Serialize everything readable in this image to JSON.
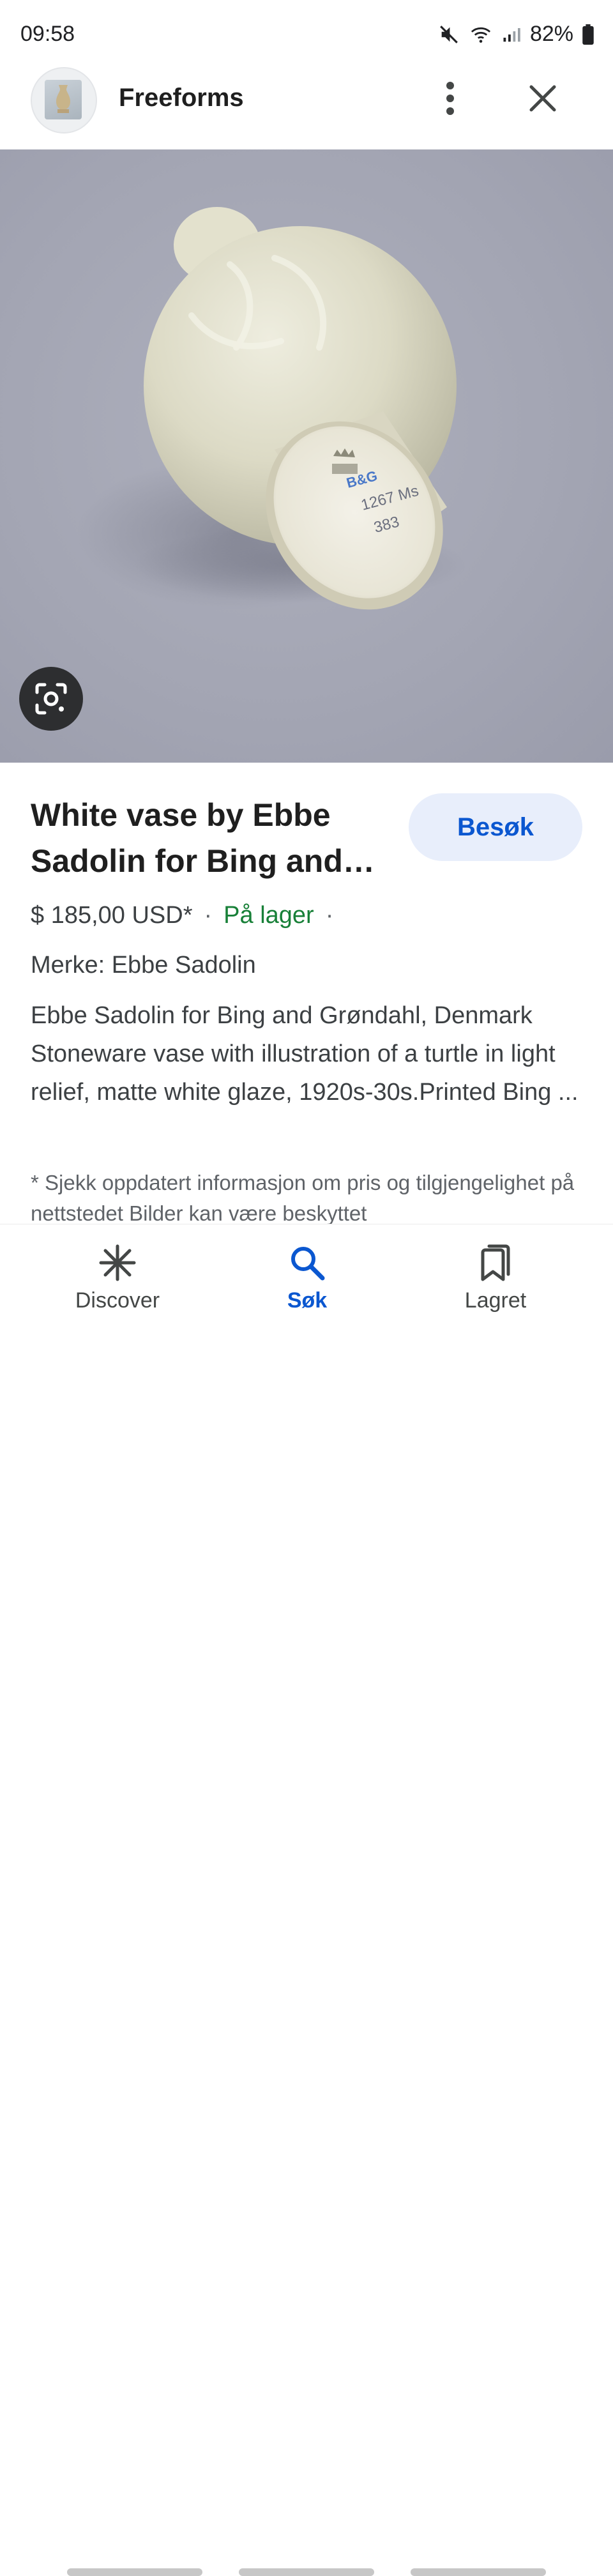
{
  "status_bar": {
    "time": "09:58",
    "battery": "82%"
  },
  "header": {
    "site_name": "Freeforms"
  },
  "product": {
    "title": "White vase by Ebbe Sadolin for Bing and…",
    "visit_label": "Besøk",
    "price": "$ 185,00 USD*",
    "separator": "·",
    "stock": "På lager",
    "brand": "Merke: Ebbe Sadolin",
    "description": "Ebbe Sadolin for Bing and Grøndahl, Denmark Stoneware vase with illustration of a turtle in light relief, matte white glaze, 1920s-30s.Printed Bing ...",
    "disclaimer": "* Sjekk oppdatert informasjon om pris og tilgjengelighet på nettstedet Bilder kan være beskyttet"
  },
  "vase_mark": {
    "line1": "B&G",
    "line2": "1267 Ms",
    "line3": "383"
  },
  "bottom_nav": {
    "items": [
      {
        "label": "Discover",
        "icon": "asterisk-icon",
        "active": false
      },
      {
        "label": "Søk",
        "icon": "search-icon",
        "active": true
      },
      {
        "label": "Lagret",
        "icon": "bookmarks-icon",
        "active": false
      }
    ]
  },
  "colors": {
    "accent": "#0b57d0",
    "stock_green": "#188038",
    "visit_bg": "#e8eefb",
    "image_bg": "#a3a5b3"
  }
}
